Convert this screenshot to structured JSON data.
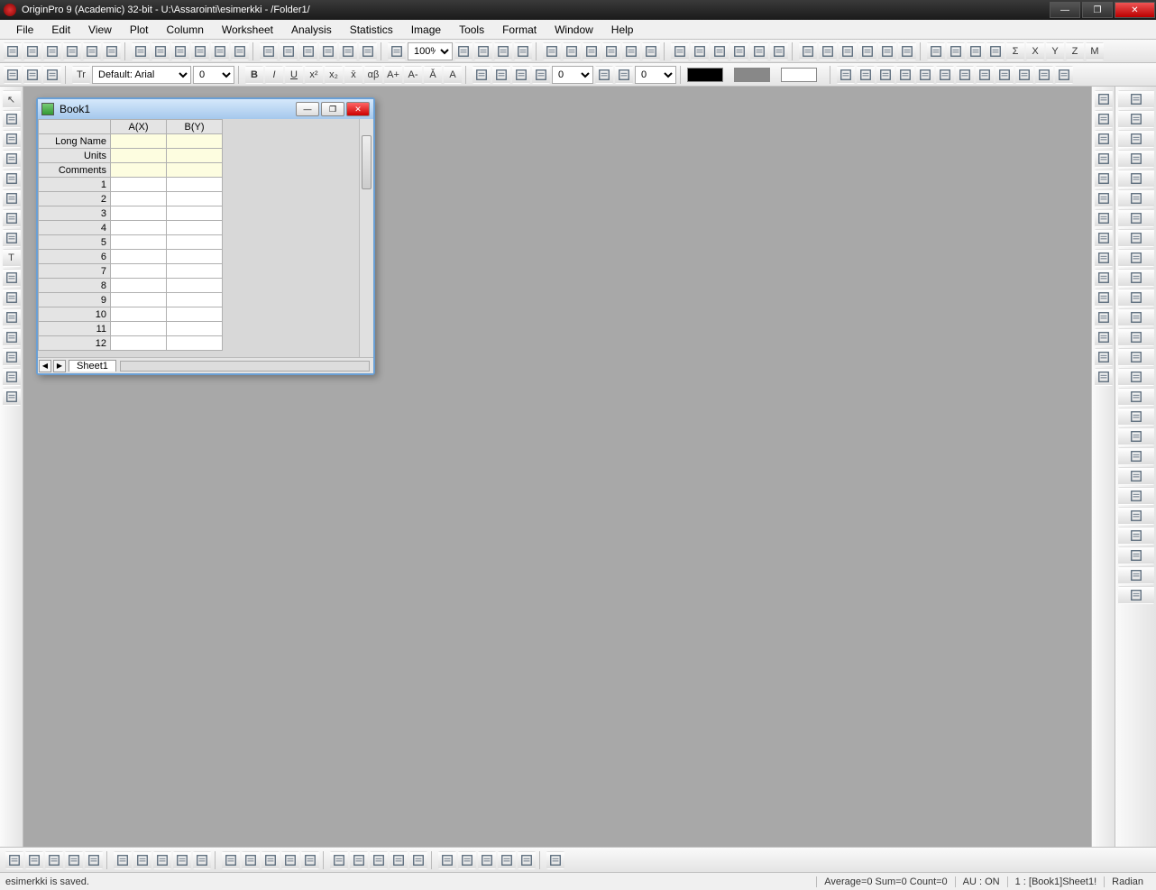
{
  "titlebar": {
    "text": "OriginPro 9 (Academic) 32-bit - U:\\Assarointi\\esimerkki - /Folder1/"
  },
  "menu": [
    "File",
    "Edit",
    "View",
    "Plot",
    "Column",
    "Worksheet",
    "Analysis",
    "Statistics",
    "Image",
    "Tools",
    "Format",
    "Window",
    "Help"
  ],
  "toolbar1": {
    "zoom": "100%",
    "icons": [
      "new",
      "open",
      "save",
      "project",
      "book",
      "excel",
      "graph",
      "layout",
      "matrix",
      "notes",
      "import",
      "import-multi",
      "import-db",
      "open-template",
      "save-template",
      "pdf",
      "print",
      "duplicate",
      "refresh",
      "zoom-combo",
      "print2",
      "slide",
      "video",
      "gadget",
      "stats",
      "screen",
      "ruler",
      "mask",
      "mask2",
      "poly",
      "target",
      "hammer",
      "settings",
      "batch",
      "col-stats",
      "row-stats",
      "anova",
      "dsp",
      "fit",
      "fft",
      "baseline",
      "peak",
      "gears",
      "filter",
      "filter2",
      "find",
      "Σ",
      "X",
      "Y",
      "Z",
      "M"
    ]
  },
  "toolbar2": {
    "font_label": "Default: Arial",
    "font_size": "0",
    "num1": "0",
    "num2": "0",
    "icons": [
      "cut",
      "copy",
      "paste",
      "font",
      "size",
      "B",
      "I",
      "U",
      "x²",
      "x₂",
      "x̄",
      "αβ",
      "A+",
      "A-",
      "Ǎ",
      "A-color",
      "line-style",
      "line-weight",
      "fill",
      "marker",
      "swatch-black",
      "swatch-gray",
      "swatch-white",
      "layer",
      "legend",
      "axes",
      "grid",
      "bulb1",
      "bulb2",
      "bulb3",
      "globe",
      "db1",
      "db2",
      "db3"
    ]
  },
  "left_tools": [
    "pointer",
    "zoom",
    "pan",
    "reader",
    "cursor",
    "region",
    "mask-tool",
    "roi",
    "text",
    "arrow",
    "line",
    "rect",
    "ellipse",
    "poly2",
    "draw",
    "ruler2"
  ],
  "right_tools": [
    "layer1",
    "layer2",
    "layer3",
    "layer4",
    "layer5",
    "axis1",
    "axis2",
    "axis3",
    "axis4",
    "style1",
    "style2",
    "style3",
    "clock",
    "gear",
    "grid2"
  ],
  "right_tools2": [
    "p1",
    "p2",
    "p3",
    "p4",
    "p5",
    "p6",
    "p7",
    "p8",
    "p9",
    "p10",
    "p11",
    "p12",
    "p13",
    "p14",
    "p15",
    "p16",
    "p17",
    "p18",
    "p19",
    "p20",
    "p21",
    "p22",
    "p23",
    "p24",
    "p25",
    "p26"
  ],
  "book": {
    "title": "Book1",
    "columns": [
      "A(X)",
      "B(Y)"
    ],
    "meta_rows": [
      "Long Name",
      "Units",
      "Comments"
    ],
    "data_rows": [
      "1",
      "2",
      "3",
      "4",
      "5",
      "6",
      "7",
      "8",
      "9",
      "10",
      "11",
      "12"
    ],
    "sheet_tab": "Sheet1"
  },
  "bottom_tools": [
    "line",
    "scatter",
    "line-scatter",
    "column",
    "bar",
    "stacked",
    "pie",
    "area",
    "3d",
    "contour",
    "stock",
    "box",
    "hist",
    "t1",
    "t2",
    "t3",
    "t4",
    "t5",
    "t6",
    "t7",
    "t8",
    "t9",
    "t10",
    "t11",
    "t12",
    "t13"
  ],
  "status": {
    "message": "esimerkki is saved.",
    "stats": "Average=0  Sum=0  Count=0",
    "au": "AU : ON",
    "loc": "1 : [Book1]Sheet1!",
    "angle": "Radian"
  }
}
